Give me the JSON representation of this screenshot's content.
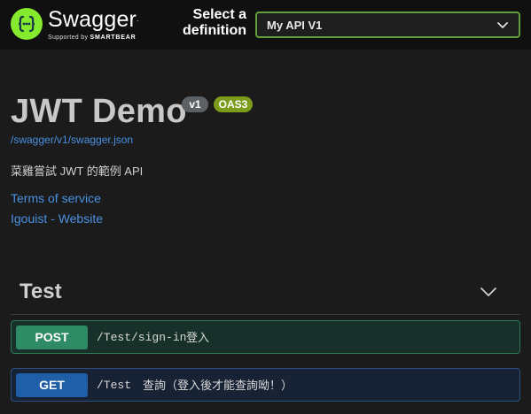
{
  "topbar": {
    "brand_name": "Swagger",
    "brand_tm": ".",
    "brand_supported": "Supported by",
    "brand_company": "SMARTBEAR",
    "definition_label_line1": "Select a",
    "definition_label_line2": "definition",
    "definition_selected": "My API V1",
    "logo_icon": "swagger-braces-icon",
    "chevron_icon": "chevron-down-icon",
    "accent_color": "#85ea2d"
  },
  "info": {
    "title": "JWT Demo",
    "version_badge": "v1",
    "oas_badge": "OAS3",
    "spec_url": "/swagger/v1/swagger.json",
    "description": "菜雞嘗試 JWT 的範例 API",
    "terms_link": "Terms of service",
    "website_link": "Igouist - Website",
    "link_color": "#4a90e2"
  },
  "tag": {
    "name": "Test",
    "toggle_icon": "chevron-down-icon"
  },
  "operations": [
    {
      "method": "POST",
      "path": "/Test/sign-in",
      "summary": "登入",
      "color": "#49cc90"
    },
    {
      "method": "GET",
      "path": "/Test",
      "summary": "查詢（登入後才能查詢呦！）",
      "color": "#61affe"
    }
  ]
}
